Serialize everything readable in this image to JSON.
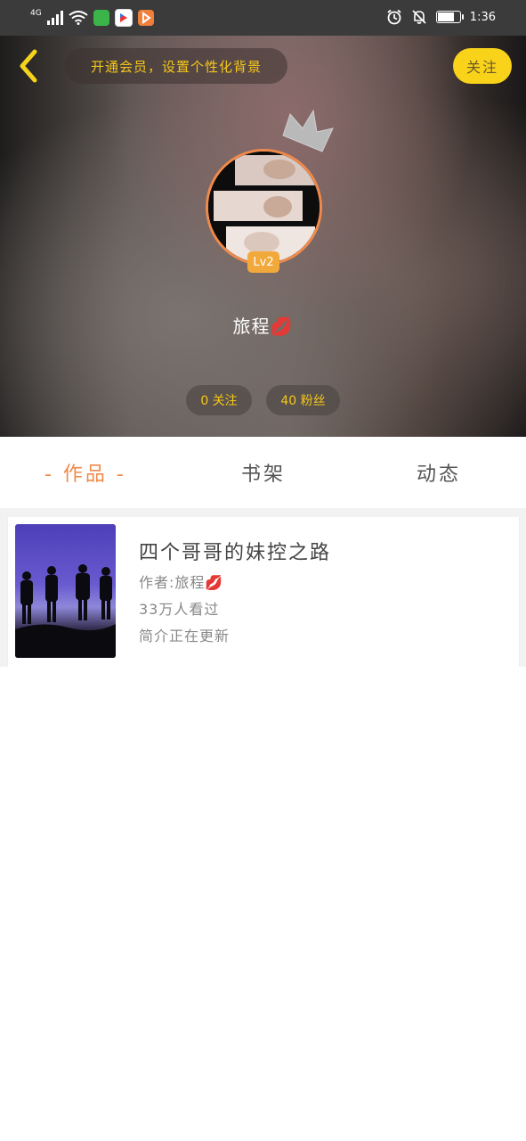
{
  "status_bar": {
    "network": "4G",
    "time": "1:36",
    "battery_level": 0.7
  },
  "header": {
    "vip_prompt": "开通会员，设置个性化背景",
    "follow_label": "关注",
    "level_badge": "Lv2",
    "username": "旅程💋",
    "following_stat": "0 关注",
    "fans_stat": "40 粉丝"
  },
  "tabs": [
    {
      "label": "- 作品 -",
      "active": true
    },
    {
      "label": "书架",
      "active": false
    },
    {
      "label": "动态",
      "active": false
    }
  ],
  "works": [
    {
      "title": "四个哥哥的妹控之路",
      "author": "作者:旅程💋",
      "views": "33万人看过",
      "intro": "简介正在更新"
    }
  ],
  "colors": {
    "accent_orange": "#f08a4b",
    "follow_yellow": "#f9d31a",
    "vip_text": "#f5c71a",
    "level_badge": "#f2a93b"
  },
  "icons": {
    "back": "chevron-left-icon",
    "crown": "crown-icon",
    "alarm": "alarm-icon",
    "mute": "bell-off-icon"
  }
}
